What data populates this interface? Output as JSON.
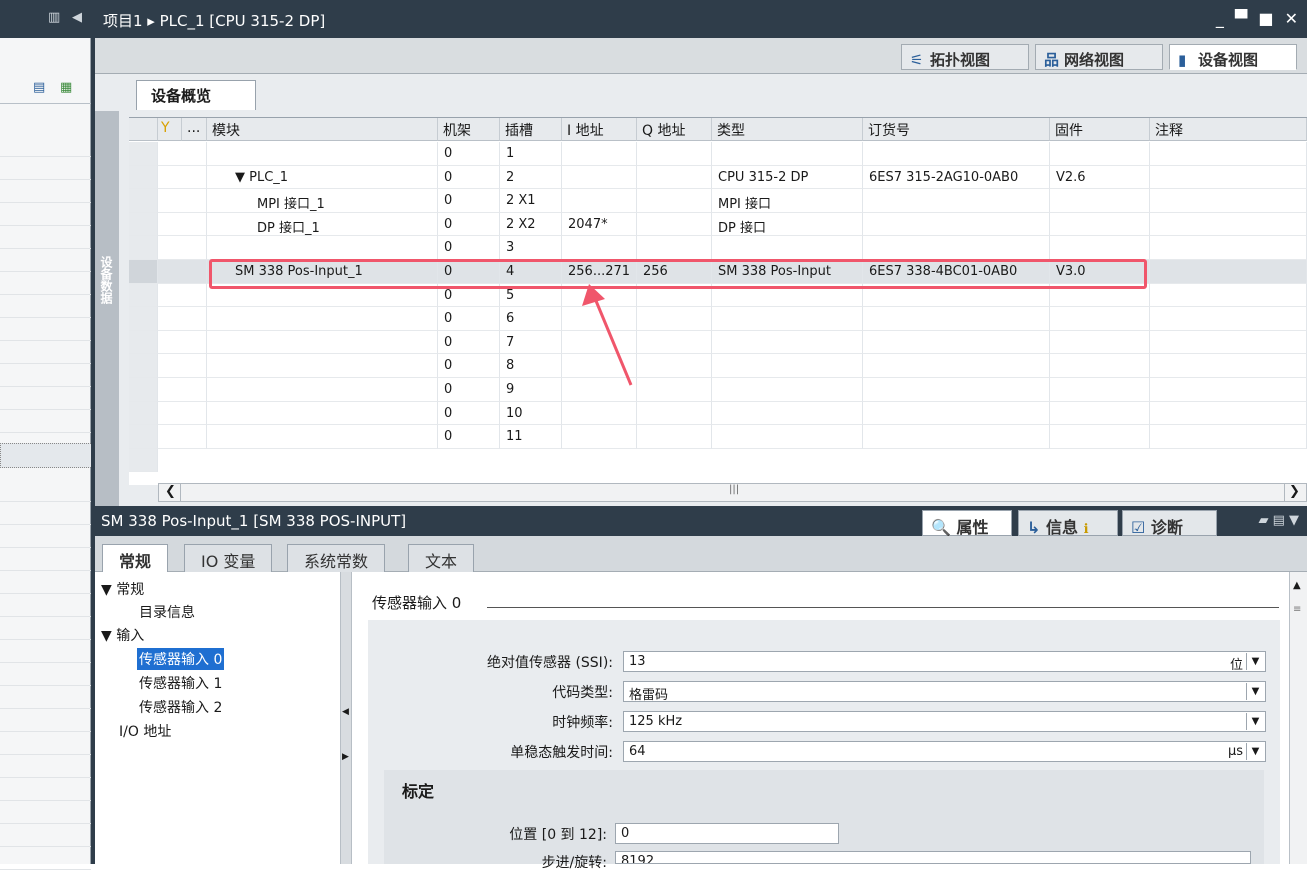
{
  "title_bar": {
    "breadcrumb": "项目1 ▸ PLC_1 [CPU 315-2 DP]",
    "window_controls": "_ ▀ ■ ✕"
  },
  "view_tabs": [
    {
      "label": "拓扑视图",
      "icon": "topology-icon",
      "active": false
    },
    {
      "label": "网络视图",
      "icon": "network-icon",
      "active": false
    },
    {
      "label": "设备视图",
      "icon": "device-icon",
      "active": true
    }
  ],
  "overview": {
    "tab_label": "设备概览",
    "side_label": "设备数据",
    "columns": [
      "模块",
      "机架",
      "插槽",
      "I 地址",
      "Q 地址",
      "类型",
      "订货号",
      "固件",
      "注释"
    ],
    "rows": [
      {
        "module": "",
        "rack": "0",
        "slot": "1",
        "i_addr": "",
        "q_addr": "",
        "type": "",
        "order": "",
        "fw": ""
      },
      {
        "module": "▼  PLC_1",
        "rack": "0",
        "slot": "2",
        "i_addr": "",
        "q_addr": "",
        "type": "CPU 315-2 DP",
        "order": "6ES7 315-2AG10-0AB0",
        "fw": "V2.6"
      },
      {
        "module": "MPI 接口_1",
        "rack": "0",
        "slot": "2 X1",
        "i_addr": "",
        "q_addr": "",
        "type": "MPI 接口",
        "order": "",
        "fw": ""
      },
      {
        "module": "DP 接口_1",
        "rack": "0",
        "slot": "2 X2",
        "i_addr": "2047*",
        "q_addr": "",
        "type": "DP 接口",
        "order": "",
        "fw": ""
      },
      {
        "module": "",
        "rack": "0",
        "slot": "3",
        "i_addr": "",
        "q_addr": "",
        "type": "",
        "order": "",
        "fw": ""
      },
      {
        "module": "SM 338 Pos-Input_1",
        "rack": "0",
        "slot": "4",
        "i_addr": "256...271",
        "q_addr": "256",
        "type": "SM 338 Pos-Input",
        "order": "6ES7 338-4BC01-0AB0",
        "fw": "V3.0"
      },
      {
        "module": "",
        "rack": "0",
        "slot": "5",
        "i_addr": "",
        "q_addr": "",
        "type": "",
        "order": "",
        "fw": ""
      },
      {
        "module": "",
        "rack": "0",
        "slot": "6",
        "i_addr": "",
        "q_addr": "",
        "type": "",
        "order": "",
        "fw": ""
      },
      {
        "module": "",
        "rack": "0",
        "slot": "7",
        "i_addr": "",
        "q_addr": "",
        "type": "",
        "order": "",
        "fw": ""
      },
      {
        "module": "",
        "rack": "0",
        "slot": "8",
        "i_addr": "",
        "q_addr": "",
        "type": "",
        "order": "",
        "fw": ""
      },
      {
        "module": "",
        "rack": "0",
        "slot": "9",
        "i_addr": "",
        "q_addr": "",
        "type": "",
        "order": "",
        "fw": ""
      },
      {
        "module": "",
        "rack": "0",
        "slot": "10",
        "i_addr": "",
        "q_addr": "",
        "type": "",
        "order": "",
        "fw": ""
      },
      {
        "module": "",
        "rack": "0",
        "slot": "11",
        "i_addr": "",
        "q_addr": "",
        "type": "",
        "order": "",
        "fw": ""
      }
    ],
    "highlight_color": "#f0566b"
  },
  "properties": {
    "title": "SM 338 Pos-Input_1 [SM 338 POS-INPUT]",
    "tabs": [
      "属性",
      "信息",
      "诊断"
    ],
    "subtabs": [
      "常规",
      "IO 变量",
      "系统常数",
      "文本"
    ],
    "nav": [
      {
        "label": "▼ 常规",
        "indent": 0
      },
      {
        "label": "目录信息",
        "indent": 1
      },
      {
        "label": "▼ 输入",
        "indent": 0
      },
      {
        "label": "传感器输入 0",
        "indent": 1,
        "selected": true
      },
      {
        "label": "传感器输入 1",
        "indent": 1
      },
      {
        "label": "传感器输入 2",
        "indent": 1
      },
      {
        "label": "I/O 地址",
        "indent": 0
      }
    ],
    "section_title": "传感器输入 0",
    "fields": [
      {
        "label": "绝对值传感器 (SSI):",
        "value": "13",
        "unit": "位"
      },
      {
        "label": "代码类型:",
        "value": "格雷码",
        "unit": ""
      },
      {
        "label": "时钟频率:",
        "value": "125 kHz",
        "unit": ""
      },
      {
        "label": "单稳态触发时间:",
        "value": "64",
        "unit": "μs"
      }
    ],
    "scaling_title": "标定",
    "position_label": "位置 [0 到 12]:",
    "position_value": "0",
    "steps_label": "步进/旋转:",
    "steps_value": "8192"
  }
}
